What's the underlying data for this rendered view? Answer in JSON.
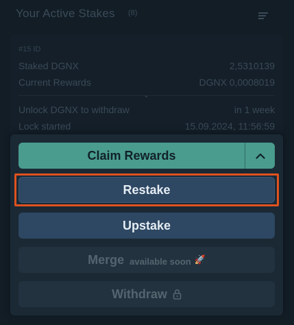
{
  "header": {
    "title": "Your Active Stakes",
    "count": "(8)"
  },
  "stake": {
    "id": "#15 ID",
    "rows_top": [
      {
        "label": "Staked DGNX",
        "value": "2,5310139"
      },
      {
        "label": "Current Rewards",
        "value": "DGNX   0,0008019"
      }
    ],
    "rows_bottom": [
      {
        "label": "Unlock DGNX to withdraw",
        "value": "in 1 week"
      },
      {
        "label": "Lock started",
        "value": "15.09.2024, 11:56:59"
      }
    ]
  },
  "actions": {
    "claim_label": "Claim Rewards",
    "restake_label": "Restake",
    "upstake_label": "Upstake",
    "merge_label": "Merge",
    "merge_note": "available soon",
    "withdraw_label": "Withdraw"
  },
  "colors": {
    "claim": "#4a9c8e",
    "primary_button": "#2e4762",
    "disabled_button": "#23323f",
    "highlight": "#e0521f"
  },
  "icons": {
    "menu": "filter-lines-icon",
    "toggle": "chevron-up-icon",
    "merge": "rocket-icon",
    "withdraw": "lock-icon"
  }
}
